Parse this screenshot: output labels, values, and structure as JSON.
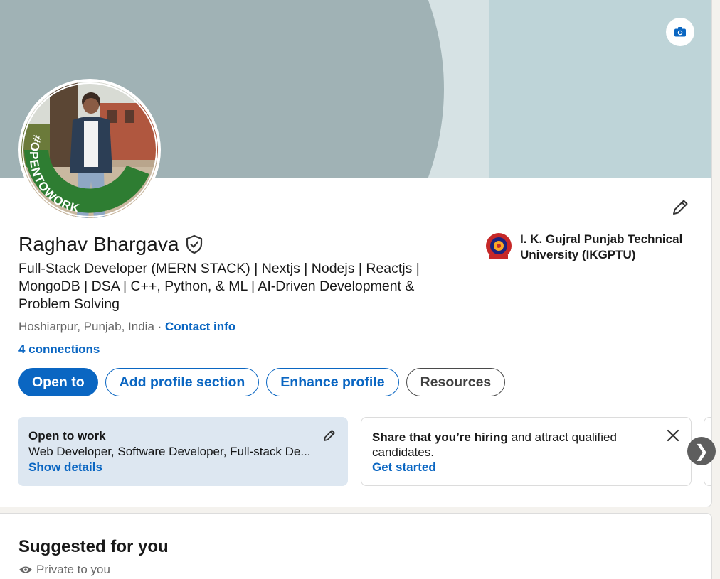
{
  "profile": {
    "name": "Raghav Bhargava",
    "headline": "Full-Stack Developer (MERN STACK) | Nextjs | Nodejs | Reactjs | MongoDB | DSA | C++, Python, & ML | AI-Driven Development & Problem Solving",
    "location": "Hoshiarpur, Punjab, India",
    "separator": " · ",
    "contact_info_label": "Contact info",
    "connections_label": "4 connections",
    "avatar_badge_text": "#OPENTOWORK"
  },
  "education": {
    "school": "I. K. Gujral Punjab Technical University (IKGPTU)"
  },
  "actions": {
    "open_to": "Open to",
    "add_section": "Add profile section",
    "enhance": "Enhance profile",
    "resources": "Resources"
  },
  "open_to_work": {
    "title": "Open to work",
    "roles": "Web Developer, Software Developer, Full-stack De...",
    "link": "Show details"
  },
  "hiring": {
    "bold": "Share that you’re hiring",
    "rest": " and attract qualified candidates.",
    "link": "Get started"
  },
  "suggested": {
    "title": "Suggested for you",
    "private": "Private to you"
  },
  "icons": {
    "camera": "camera-icon",
    "edit": "pencil-icon",
    "verify": "shield-check-icon",
    "close": "close-icon",
    "next": "chevron-right-icon",
    "eye": "eye-icon"
  },
  "colors": {
    "brand": "#0a66c2",
    "otw_green": "#2e7d32",
    "otw_card_bg": "#dde7f1"
  },
  "carousel": {
    "next_glyph": "❯"
  }
}
